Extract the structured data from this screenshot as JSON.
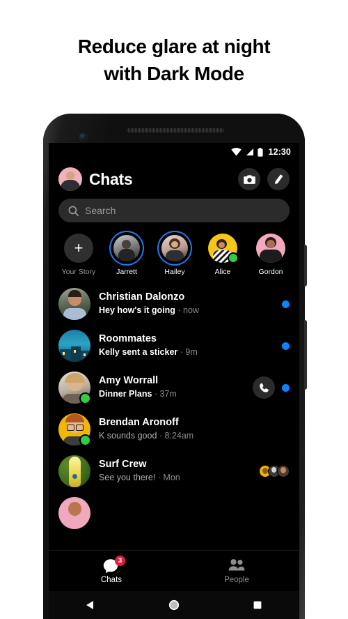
{
  "promo": {
    "headline_line1": "Reduce glare at night",
    "headline_line2": "with Dark Mode"
  },
  "status_bar": {
    "time": "12:30",
    "icons": [
      "wifi-icon",
      "cellular-signal-icon",
      "battery-icon"
    ]
  },
  "header": {
    "title": "Chats",
    "avatar_name": "profile-avatar",
    "camera_label": "Camera",
    "compose_label": "New message"
  },
  "search": {
    "placeholder": "Search",
    "value": "",
    "icon": "search-icon"
  },
  "stories": [
    {
      "label": "Your Story",
      "type": "add",
      "ring": false,
      "online": false,
      "muted": true
    },
    {
      "label": "Jarrett",
      "type": "photo",
      "ring": true,
      "online": false,
      "muted": false
    },
    {
      "label": "Hailey",
      "type": "photo",
      "ring": true,
      "online": false,
      "muted": false
    },
    {
      "label": "Alice",
      "type": "photo",
      "ring": false,
      "online": true,
      "muted": false
    },
    {
      "label": "Gordon",
      "type": "photo",
      "ring": false,
      "online": false,
      "muted": false
    }
  ],
  "chats": [
    {
      "name": "Christian Dalonzo",
      "message": "Hey how's it going",
      "time": "now",
      "unread": true,
      "online": false,
      "call_button": false,
      "receipts": 0
    },
    {
      "name": "Roommates",
      "message": "Kelly sent a sticker",
      "time": "9m",
      "unread": true,
      "online": false,
      "call_button": false,
      "receipts": 0
    },
    {
      "name": "Amy Worrall",
      "message": "Dinner Plans",
      "time": "37m",
      "unread": true,
      "online": true,
      "call_button": true,
      "receipts": 0
    },
    {
      "name": "Brendan Aronoff",
      "message": "K sounds good",
      "time": "8:24am",
      "unread": false,
      "online": true,
      "call_button": false,
      "receipts": 0
    },
    {
      "name": "Surf Crew",
      "message": "See you there!",
      "time": "Mon",
      "unread": false,
      "online": false,
      "call_button": false,
      "receipts": 3
    }
  ],
  "bottom_nav": [
    {
      "label": "Chats",
      "icon": "chat-bubble-icon",
      "active": true,
      "badge": "3"
    },
    {
      "label": "People",
      "icon": "people-icon",
      "active": false,
      "badge": ""
    }
  ],
  "android_nav": {
    "back": "back-triangle-icon",
    "home": "home-circle-icon",
    "recents": "recents-square-icon"
  },
  "colors": {
    "accent_blue": "#0a84ff",
    "story_ring": "#1a7ced",
    "online_green": "#31cc46",
    "badge_red": "#e41e3f",
    "screen_bg": "#000000",
    "surface": "#2b2b2b"
  }
}
